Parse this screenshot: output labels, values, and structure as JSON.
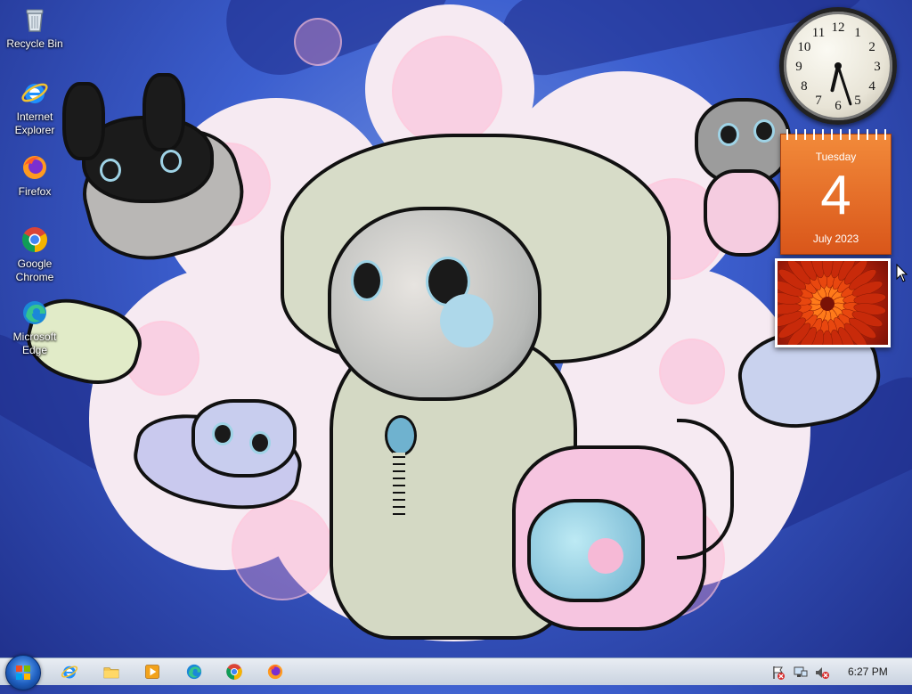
{
  "desktop": {
    "icons": [
      {
        "label": "Recycle Bin",
        "icon": "recycle-bin-icon"
      },
      {
        "label": "Internet Explorer",
        "icon": "internet-explorer-icon"
      },
      {
        "label": "Firefox",
        "icon": "firefox-icon"
      },
      {
        "label": "Google Chrome",
        "icon": "chrome-icon"
      },
      {
        "label": "Microsoft Edge",
        "icon": "edge-icon"
      }
    ]
  },
  "gadgets": {
    "clock": {
      "hour": 6,
      "minute": 27
    },
    "calendar": {
      "weekday": "Tuesday",
      "day": "4",
      "month_year": "July 2023",
      "color": "#e8661f"
    },
    "slideshow": {
      "subject": "orange-flower"
    }
  },
  "taskbar": {
    "pinned": [
      "internet-explorer-icon",
      "file-explorer-icon",
      "media-player-icon",
      "edge-icon",
      "chrome-icon",
      "firefox-icon"
    ],
    "tray": {
      "icons": [
        "action-center-icon",
        "network-icon",
        "volume-muted-icon"
      ],
      "time": "6:27 PM"
    }
  }
}
